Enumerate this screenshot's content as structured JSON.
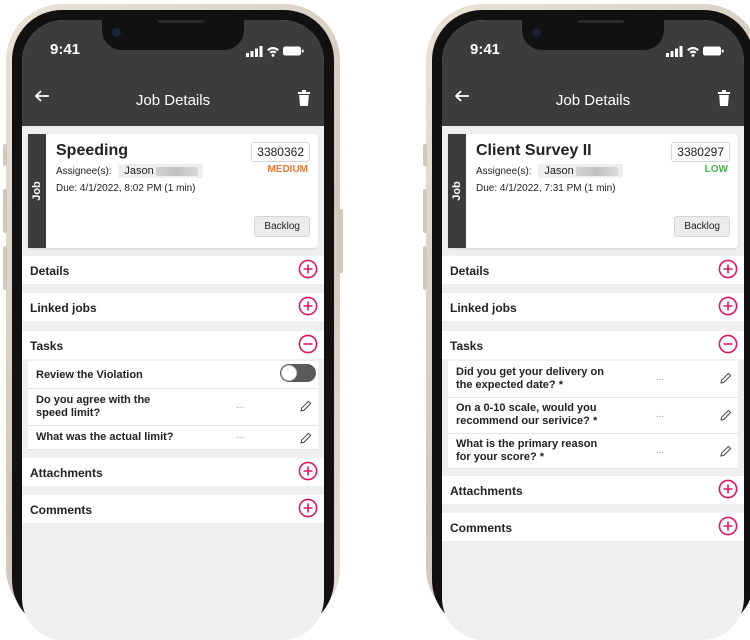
{
  "accent_color": "#d81b60",
  "statusbar": {
    "time": "9:41"
  },
  "appbar": {
    "title": "Job Details"
  },
  "phones": [
    {
      "job": {
        "tab": "Job",
        "title": "Speeding",
        "id": "3380362",
        "priority": "MEDIUM",
        "priority_color": "#e07b39",
        "assignee_label": "Assignee(s):",
        "assignee_name": "Jason",
        "due": "Due: 4/1/2022, 8:02 PM (1 min)",
        "status_button": "Backlog"
      },
      "sections": {
        "details": "Details",
        "linked": "Linked jobs",
        "tasks": "Tasks",
        "attachments": "Attachments",
        "comments": "Comments"
      },
      "tasks": [
        {
          "label": "Review the Violation",
          "type": "toggle"
        },
        {
          "label": "Do you agree with the speed limit?",
          "type": "text",
          "value": "..."
        },
        {
          "label": "What was the actual limit?",
          "type": "text",
          "value": "..."
        }
      ]
    },
    {
      "job": {
        "tab": "Job",
        "title": "Client Survey II",
        "id": "3380297",
        "priority": "LOW",
        "priority_color": "#4caf50",
        "assignee_label": "Assignee(s):",
        "assignee_name": "Jason",
        "due": "Due: 4/1/2022, 7:31 PM (1 min)",
        "status_button": "Backlog"
      },
      "sections": {
        "details": "Details",
        "linked": "Linked jobs",
        "tasks": "Tasks",
        "attachments": "Attachments",
        "comments": "Comments"
      },
      "tasks": [
        {
          "label": "Did you get your delivery on the expected date? *",
          "type": "text",
          "value": "..."
        },
        {
          "label": "On a 0-10 scale, would you recommend our serivice? *",
          "type": "text",
          "value": "..."
        },
        {
          "label": "What is the primary reason for your score? *",
          "type": "text",
          "value": "..."
        }
      ]
    }
  ]
}
